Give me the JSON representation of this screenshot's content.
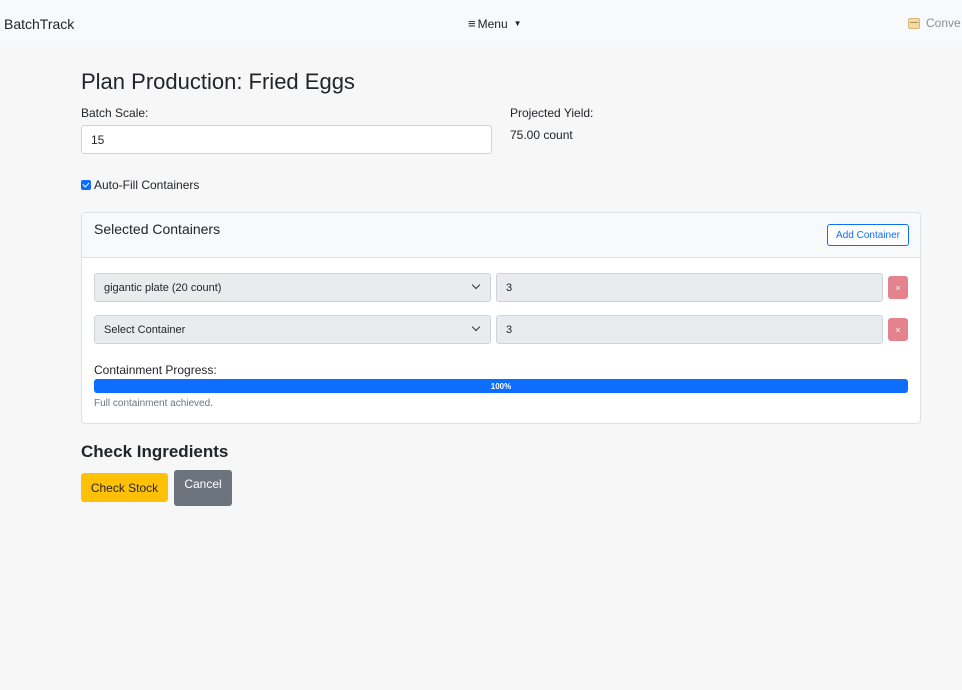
{
  "navbar": {
    "brand": "BatchTrack",
    "menu_label": "Menu",
    "right_link": "Conve"
  },
  "page": {
    "title": "Plan Production: Fried Eggs"
  },
  "batch": {
    "scale_label": "Batch Scale:",
    "scale_value": "15",
    "yield_label": "Projected Yield:",
    "yield_value": "75.00 count",
    "autofill_label": "Auto-Fill Containers",
    "autofill_checked": true
  },
  "containers": {
    "header": "Selected Containers",
    "add_label": "Add Container",
    "rows": [
      {
        "container": "gigantic plate (20 count)",
        "quantity": "3",
        "remove": "×"
      },
      {
        "container": "Select Container",
        "quantity": "3",
        "remove": "×"
      }
    ],
    "progress_label": "Containment Progress:",
    "progress_percent": 100,
    "progress_text": "100%",
    "progress_note": "Full containment achieved."
  },
  "ingredients": {
    "title": "Check Ingredients",
    "check_label": "Check Stock",
    "cancel_label": "Cancel"
  },
  "colors": {
    "primary": "#0d6efd",
    "warning": "#ffc107",
    "secondary": "#6c757d",
    "danger": "#e4838d"
  }
}
